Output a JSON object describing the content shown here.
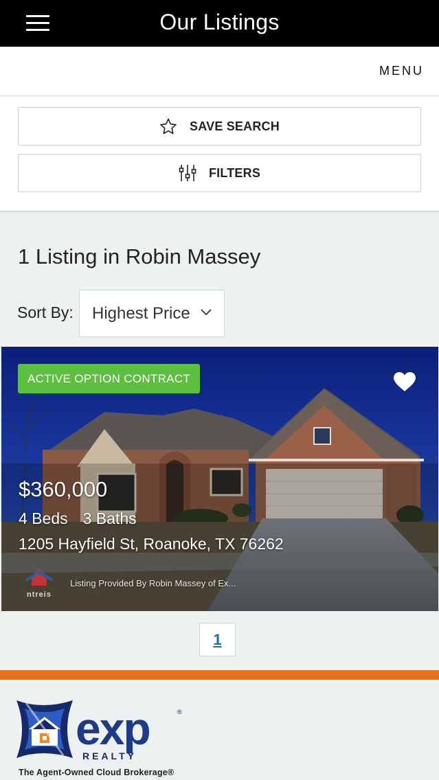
{
  "app_bar": {
    "title": "Our Listings"
  },
  "menu_bar": {
    "menu_label": "MENU"
  },
  "actions": {
    "save_search_label": "SAVE SEARCH",
    "filters_label": "FILTERS"
  },
  "results": {
    "title": "1 Listing in Robin Massey"
  },
  "sort": {
    "label": "Sort By:",
    "selected": "Highest Price"
  },
  "listing": {
    "status": "ACTIVE OPTION CONTRACT",
    "price": "$360,000",
    "beds": "4 Beds",
    "baths": "3 Baths",
    "address": "1205 Hayfield St, Roanoke, TX 76262",
    "provided_by": "Listing Provided By Robin Massey of Ex...",
    "status_color": "#5cbf3f"
  },
  "pagination": {
    "current": "1"
  },
  "footer": {
    "brand_logo_text": "eXp REALTY",
    "tagline": "The Agent-Owned Cloud Brokerage®",
    "stripe_color": "#e8711e"
  }
}
